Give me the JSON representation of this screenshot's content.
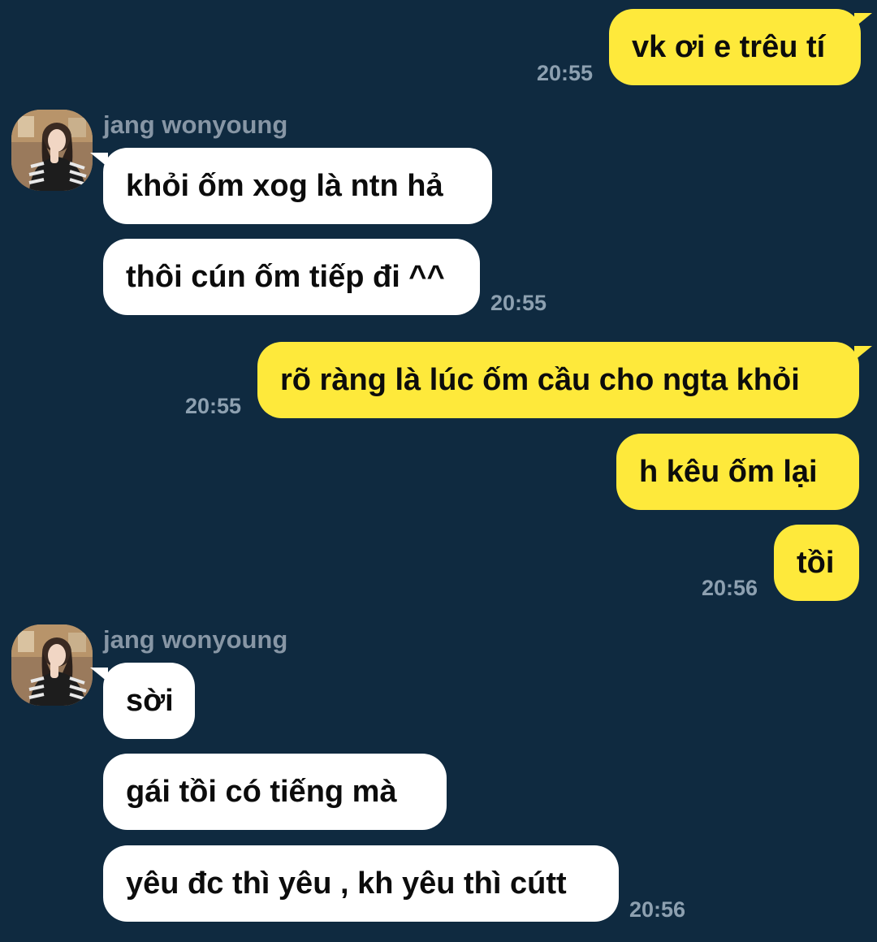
{
  "contact": {
    "name": "jang wonyoung"
  },
  "messages": [
    {
      "side": "out",
      "text": "vk ơi e trêu tí",
      "time": "20:55"
    },
    {
      "side": "in",
      "text": "khỏi ốm xog là ntn hả"
    },
    {
      "side": "in",
      "text": "thôi cún ốm tiếp đi ^^",
      "time": "20:55"
    },
    {
      "side": "out",
      "text": "rõ ràng là lúc ốm cầu cho ngta khỏi",
      "time": "20:55"
    },
    {
      "side": "out",
      "text": "h kêu ốm lại"
    },
    {
      "side": "out",
      "text": "tồi",
      "time": "20:56"
    },
    {
      "side": "in",
      "text": "sời"
    },
    {
      "side": "in",
      "text": "gái tồi có tiếng mà"
    },
    {
      "side": "in",
      "text": "yêu đc thì yêu , kh yêu thì cútt",
      "time": "20:56"
    }
  ],
  "colors": {
    "background": "#0f2a40",
    "outgoing_bubble": "#fee93b",
    "incoming_bubble": "#ffffff",
    "timestamp": "#8da0b0",
    "sender_name": "#8796a5"
  },
  "icons": {
    "avatar": "profile-photo"
  }
}
